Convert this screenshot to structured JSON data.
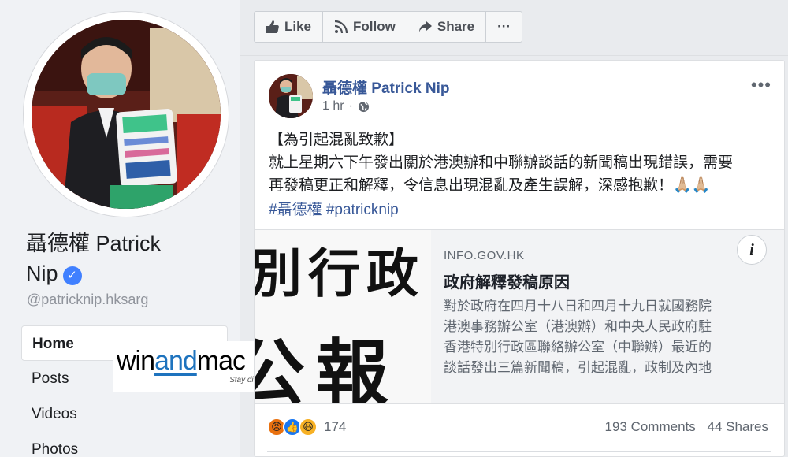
{
  "profile": {
    "name_line1": "聶德權 Patrick",
    "name_line2": "Nip",
    "handle": "@patricknip.hksarg",
    "verified_icon": "check-icon"
  },
  "nav": {
    "items": [
      {
        "label": "Home",
        "active": true
      },
      {
        "label": "Posts"
      },
      {
        "label": "Videos"
      },
      {
        "label": "Photos"
      }
    ]
  },
  "watermark": {
    "part1": "win",
    "part2": "and",
    "part3": "mac",
    "tagline": "Stay different"
  },
  "actions": {
    "like": "Like",
    "follow": "Follow",
    "share": "Share",
    "more": "···"
  },
  "post": {
    "author": "聶德權 Patrick Nip",
    "time": "1 hr",
    "audience_icon": "globe-icon",
    "more": "•••",
    "text_line1": "【為引起混亂致歉】",
    "text_line2": "就上星期六下午發出關於港澳辦和中聯辦談話的新聞稿出現錯誤，需要",
    "text_line3": "再發稿更正和解釋，令信息出現混亂及產生誤解，深感抱歉！🙏🏼🙏🏼",
    "hashtag1": "#聶德權",
    "hashtag2": "#patricknip"
  },
  "link": {
    "image_text_row1": "別行政",
    "image_text_row2": "公報",
    "domain": "INFO.GOV.HK",
    "title": "政府解釋發稿原因",
    "desc_line1": "對於政府在四月十八日和四月十九日就國務院",
    "desc_line2": "港澳事務辦公室（港澳辦）和中央人民政府駐",
    "desc_line3": "香港特別行政區聯絡辦公室（中聯辦）最近的",
    "desc_line4": "談話發出三篇新聞稿，引起混亂，政制及內地",
    "info_label": "i"
  },
  "footer": {
    "reaction_count": "174",
    "comments": "193 Comments",
    "shares": "44 Shares"
  }
}
